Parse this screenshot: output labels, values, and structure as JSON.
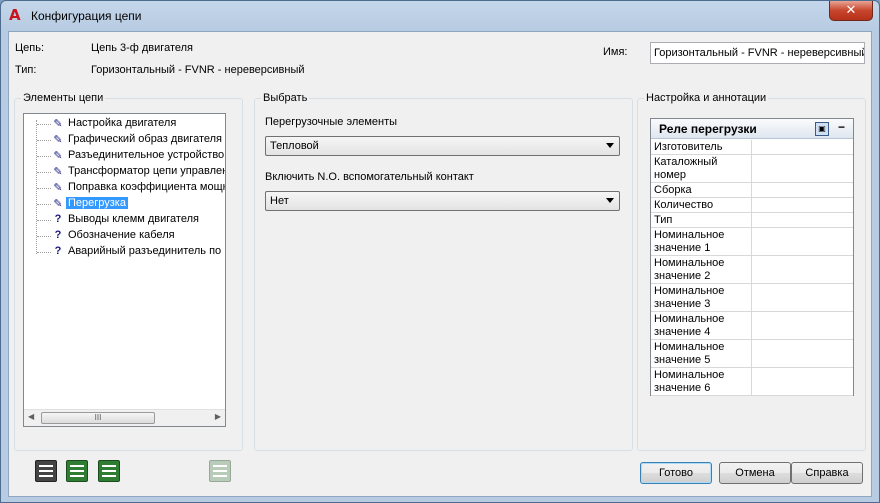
{
  "window": {
    "title": "Конфигурация цепи",
    "close_label": "✕"
  },
  "header": {
    "circuit_label": "Цепь:",
    "circuit_value": "Цепь 3-ф двигателя",
    "type_label": "Тип:",
    "type_value": "Горизонтальный - FVNR - нереверсивный",
    "name_label": "Имя:",
    "name_value": "Горизонтальный - FVNR - нереверсивный"
  },
  "elements_group": {
    "title": "Элементы цепи",
    "items": [
      {
        "icon": "pencil-icon",
        "glyph": "✎",
        "label": "Настройка двигателя"
      },
      {
        "icon": "pencil-icon",
        "glyph": "✎",
        "label": "Графический образ двигателя"
      },
      {
        "icon": "pencil-icon",
        "glyph": "✎",
        "label": "Разъединительное устройство"
      },
      {
        "icon": "pencil-icon",
        "glyph": "✎",
        "label": "Трансформатор цепи управления"
      },
      {
        "icon": "pencil-icon",
        "glyph": "✎",
        "label": "Поправка коэффициента мощности"
      },
      {
        "icon": "pencil-icon",
        "glyph": "✎",
        "label": "Перегрузка",
        "selected": true
      },
      {
        "icon": "question-icon",
        "glyph": "?",
        "label": "Выводы клемм двигателя"
      },
      {
        "icon": "question-icon",
        "glyph": "?",
        "label": "Обозначение кабеля"
      },
      {
        "icon": "question-icon",
        "glyph": "?",
        "label": "Аварийный разъединитель по"
      }
    ],
    "scroll_thumb": "III"
  },
  "select_group": {
    "title": "Выбрать",
    "overload_label": "Перегрузочные элементы",
    "overload_value": "Тепловой",
    "contact_label": "Включить N.O. вспомогательный контакт",
    "contact_value": "Нет"
  },
  "annotation_group": {
    "title": "Настройка и аннотации",
    "panel_title": "Реле перегрузки",
    "collapse_label": "−",
    "properties": [
      {
        "name": "Изготовитель",
        "value": ""
      },
      {
        "name": "Каталожный номер",
        "value": ""
      },
      {
        "name": "Сборка",
        "value": ""
      },
      {
        "name": "Количество",
        "value": ""
      },
      {
        "name": "Тип",
        "value": ""
      },
      {
        "name": "Номинальное значение 1",
        "value": ""
      },
      {
        "name": "Номинальное значение 2",
        "value": ""
      },
      {
        "name": "Номинальное значение 3",
        "value": ""
      },
      {
        "name": "Номинальное значение 4",
        "value": ""
      },
      {
        "name": "Номинальное значение 5",
        "value": ""
      },
      {
        "name": "Номинальное значение 6",
        "value": ""
      }
    ]
  },
  "footer": {
    "ok_label": "Готово",
    "cancel_label": "Отмена",
    "help_label": "Справка"
  }
}
